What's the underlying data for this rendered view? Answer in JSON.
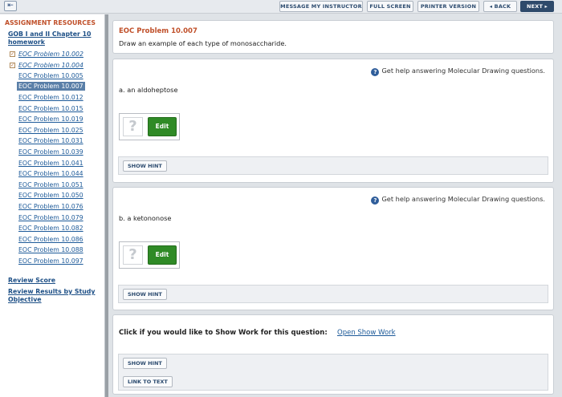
{
  "toolbar": {
    "back_icon": "⇤",
    "message_instructor": "MESSAGE MY INSTRUCTOR",
    "full_screen": "FULL SCREEN",
    "printer_version": "PRINTER VERSION",
    "back": "◂ BACK",
    "next": "NEXT ▸"
  },
  "sidebar": {
    "title": "ASSIGNMENT RESOURCES",
    "chapter": "GOB I and II Chapter 10 homework",
    "items": [
      {
        "label": "EOC Problem 10.002",
        "checked": true
      },
      {
        "label": "EOC Problem 10.004",
        "checked": true
      },
      {
        "label": "EOC Problem 10.005"
      },
      {
        "label": "EOC Problem 10.007",
        "selected": true
      },
      {
        "label": "EOC Problem 10.012"
      },
      {
        "label": "EOC Problem 10.015"
      },
      {
        "label": "EOC Problem 10.019"
      },
      {
        "label": "EOC Problem 10.025"
      },
      {
        "label": "EOC Problem 10.031"
      },
      {
        "label": "EOC Problem 10.039"
      },
      {
        "label": "EOC Problem 10.041"
      },
      {
        "label": "EOC Problem 10.044"
      },
      {
        "label": "EOC Problem 10.051"
      },
      {
        "label": "EOC Problem 10.050"
      },
      {
        "label": "EOC Problem 10.076"
      },
      {
        "label": "EOC Problem 10.079"
      },
      {
        "label": "EOC Problem 10.082"
      },
      {
        "label": "EOC Problem 10.086"
      },
      {
        "label": "EOC Problem 10.088"
      },
      {
        "label": "EOC Problem 10.097"
      }
    ],
    "review_score": "Review Score",
    "review_results": "Review Results by Study Objective"
  },
  "problem": {
    "title": "EOC Problem 10.007",
    "instruction": "Draw an example of each type of monosaccharide."
  },
  "parts": [
    {
      "help": "Get help answering Molecular Drawing questions.",
      "prompt": "a. an aldoheptose",
      "edit": "Edit",
      "show_hint": "SHOW HINT"
    },
    {
      "help": "Get help answering Molecular Drawing questions.",
      "prompt": "b. a ketononose",
      "edit": "Edit",
      "show_hint": "SHOW HINT"
    }
  ],
  "show_work": {
    "label": "Click if you would like to Show Work for this question:",
    "link": "Open Show Work",
    "show_hint": "SHOW HINT",
    "link_to_text": "LINK TO TEXT"
  }
}
